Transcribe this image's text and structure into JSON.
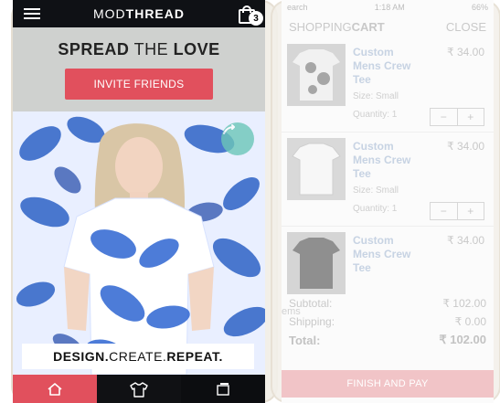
{
  "app": {
    "brand_left": "MOD",
    "brand_right": "THREAD",
    "cart_count": "3"
  },
  "promo": {
    "title_bold": "SPREAD",
    "title_light": "THE",
    "title_end": "LOVE",
    "button": "INVITE FRIENDS"
  },
  "hero": {
    "tagline_part1": "DESIGN.",
    "tagline_part2": "CREATE.",
    "tagline_part3": "REPEAT."
  },
  "bottom_tabs": [
    {
      "name": "home",
      "icon": "home-icon"
    },
    {
      "name": "shop",
      "icon": "tshirt-icon"
    },
    {
      "name": "collections",
      "icon": "layers-icon"
    }
  ],
  "cart": {
    "status_left": "earch",
    "status_time": "1:18 AM",
    "status_battery": "66%",
    "title_light": "SHOPPING",
    "title_bold": "CART",
    "close": "CLOSE",
    "items": [
      {
        "name": "Custom Mens Crew Tee",
        "price": "₹ 34.00",
        "size": "Size: Small",
        "qty": "Quantity: 1"
      },
      {
        "name": "Custom Mens Crew Tee",
        "price": "₹ 34.00",
        "size": "Size: Small",
        "qty": "Quantity: 1"
      },
      {
        "name": "Custom Mens Crew Tee",
        "price": "₹ 34.00"
      }
    ],
    "items_label": "ems",
    "subtotal_label": "Subtotal:",
    "subtotal_value": "₹ 102.00",
    "shipping_label": "Shipping:",
    "shipping_value": "₹ 0.00",
    "total_label": "Total:",
    "total_value": "₹ 102.00",
    "finish_button": "FINISH AND PAY"
  }
}
